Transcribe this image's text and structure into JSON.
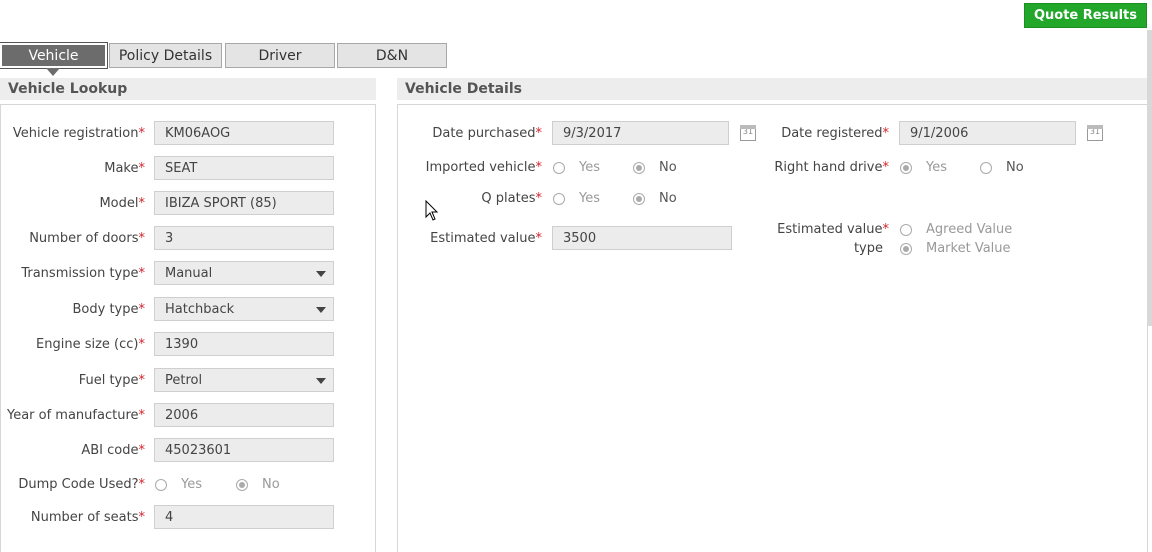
{
  "header": {
    "quote_button": "Quote Results"
  },
  "tabs": [
    {
      "label": "Vehicle",
      "active": true
    },
    {
      "label": "Policy Details",
      "active": false
    },
    {
      "label": "Driver",
      "active": false
    },
    {
      "label": "D&N",
      "active": false
    }
  ],
  "lookup": {
    "title": "Vehicle Lookup",
    "fields": {
      "registration": {
        "label": "Vehicle registration",
        "value": "KM06AOG"
      },
      "make": {
        "label": "Make",
        "value": "SEAT"
      },
      "model": {
        "label": "Model",
        "value": "IBIZA SPORT (85)"
      },
      "doors": {
        "label": "Number of doors",
        "value": "3"
      },
      "transmission": {
        "label": "Transmission type",
        "value": "Manual"
      },
      "body": {
        "label": "Body type",
        "value": "Hatchback"
      },
      "engine": {
        "label": "Engine size (cc)",
        "value": "1390"
      },
      "fuel": {
        "label": "Fuel type",
        "value": "Petrol"
      },
      "year": {
        "label": "Year of manufacture",
        "value": "2006"
      },
      "abi": {
        "label": "ABI code",
        "value": "45023601"
      },
      "dump": {
        "label": "Dump Code Used?",
        "yes": "Yes",
        "no": "No",
        "selected": "No"
      },
      "seats": {
        "label": "Number of seats",
        "value": "4"
      }
    }
  },
  "details": {
    "title": "Vehicle Details",
    "date_purchased": {
      "label": "Date purchased",
      "value": "9/3/2017"
    },
    "date_registered": {
      "label": "Date registered",
      "value": "9/1/2006"
    },
    "imported": {
      "label": "Imported vehicle",
      "yes": "Yes",
      "no": "No",
      "selected": "No"
    },
    "rhd": {
      "label": "Right hand drive",
      "yes": "Yes",
      "no": "No",
      "selected": "Yes"
    },
    "q_plates": {
      "label": "Q plates",
      "yes": "Yes",
      "no": "No",
      "selected": "No"
    },
    "est_value": {
      "label": "Estimated value",
      "value": "3500"
    },
    "est_type": {
      "label_line1": "Estimated value",
      "label_line2": "type",
      "opt1": "Agreed Value",
      "opt2": "Market Value",
      "selected": "Market Value"
    },
    "calendar_icon_text": "31"
  },
  "required_mark": "*"
}
